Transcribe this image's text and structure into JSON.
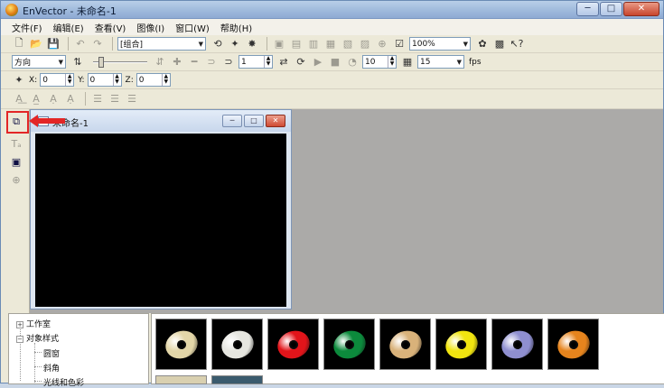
{
  "window": {
    "title": "EnVector - 未命名-1",
    "controls": {
      "minimize": "─",
      "maximize": "□",
      "close": "✕"
    }
  },
  "menu": [
    "文件(F)",
    "编辑(E)",
    "查看(V)",
    "图像(I)",
    "窗口(W)",
    "帮助(H)"
  ],
  "toolbar1": {
    "group_combo": "[组合]",
    "zoom_combo": "100%"
  },
  "toolbar2": {
    "direction_combo": "方向",
    "frame_spin": "1",
    "delay_spin": "10",
    "fps_value": "15",
    "fps_label": "fps"
  },
  "toolbar3": {
    "x_label": "X:",
    "x_value": "0",
    "y_label": "Y:",
    "y_value": "0",
    "z_label": "Z:",
    "z_value": "0"
  },
  "child_window": {
    "title": "未命名-1"
  },
  "tree": {
    "items": [
      {
        "label": "工作室",
        "expander": "+"
      },
      {
        "label": "对象样式",
        "expander": "−"
      },
      {
        "label": "圆窗"
      },
      {
        "label": "斜角"
      },
      {
        "label": "光线和色彩"
      }
    ]
  },
  "gallery": {
    "items": [
      {
        "name": "beige-ring",
        "color": "#e3d6a8"
      },
      {
        "name": "white-ring",
        "color": "#e6e6e0"
      },
      {
        "name": "red-ring",
        "color": "#e2141a"
      },
      {
        "name": "green-ring",
        "color": "#0c8a3c"
      },
      {
        "name": "gold-ring",
        "color": "#d9b27a"
      },
      {
        "name": "yellow-ring",
        "color": "#f1e510"
      },
      {
        "name": "lavender-ring",
        "color": "#8f8fd0"
      },
      {
        "name": "orange-ring",
        "color": "#e6841d"
      }
    ]
  },
  "colors": {
    "highlight": "#e32626",
    "canvas": "#000000",
    "mdi_background": "#abaaa8"
  }
}
